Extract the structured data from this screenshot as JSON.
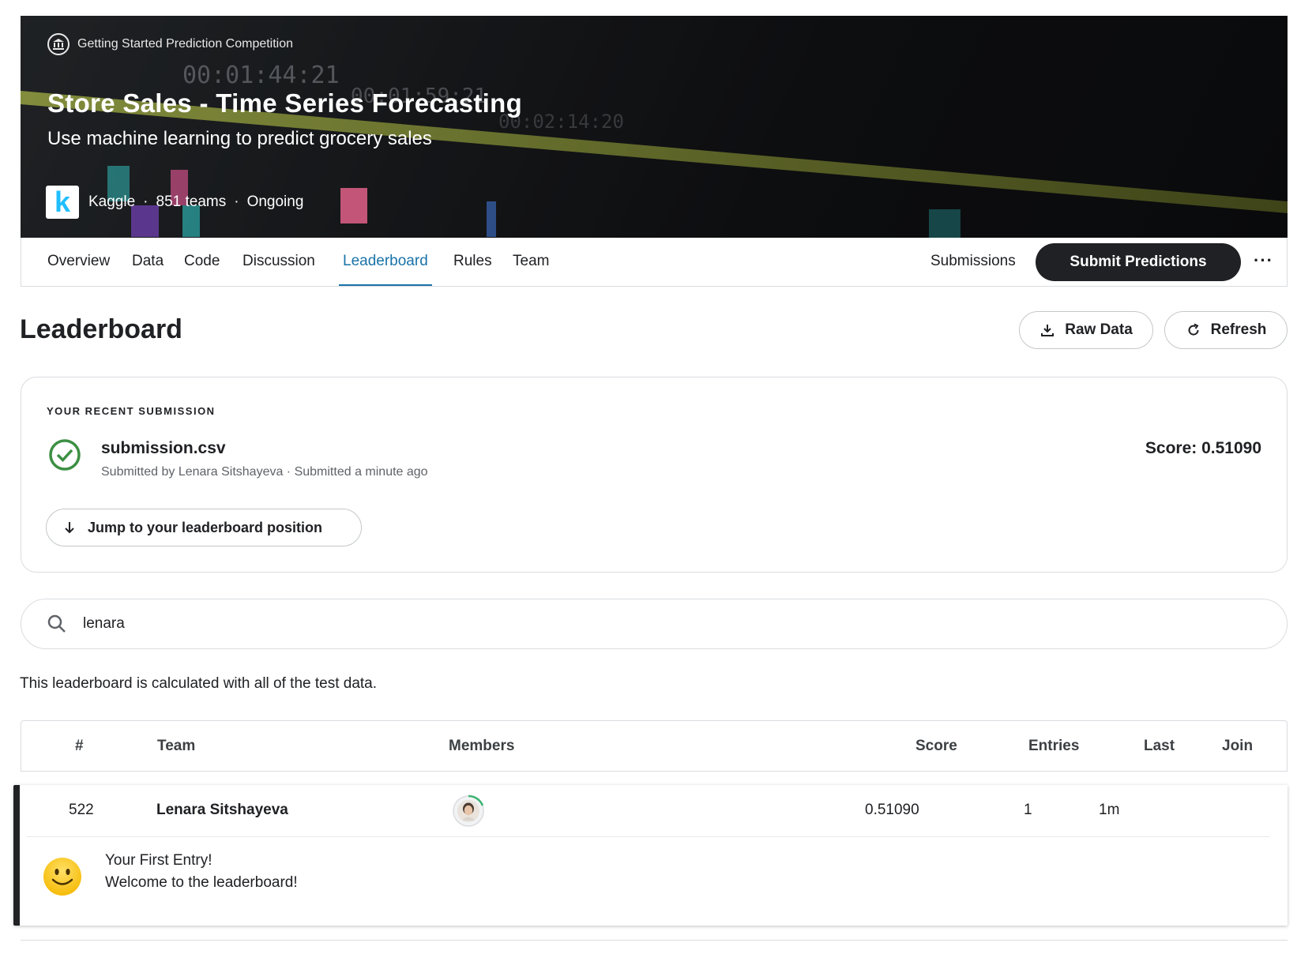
{
  "banner": {
    "competition_type": "Getting Started Prediction Competition",
    "title": "Store Sales - Time Series Forecasting",
    "subtitle": "Use machine learning to predict grocery sales",
    "host": "Kaggle",
    "teams": "851 teams",
    "status": "Ongoing",
    "logo_letter": "k"
  },
  "tabs": [
    {
      "label": "Overview"
    },
    {
      "label": "Data"
    },
    {
      "label": "Code"
    },
    {
      "label": "Discussion"
    },
    {
      "label": "Leaderboard"
    },
    {
      "label": "Rules"
    },
    {
      "label": "Team"
    }
  ],
  "nav_actions": {
    "submissions": "Submissions",
    "submit": "Submit Predictions",
    "more": "···"
  },
  "leaderboard": {
    "title": "Leaderboard",
    "raw_data": "Raw Data",
    "refresh": "Refresh"
  },
  "recent": {
    "label": "YOUR RECENT SUBMISSION",
    "filename": "submission.csv",
    "byline": "Submitted by Lenara Sitshayeva · Submitted a minute ago",
    "score": "Score: 0.51090",
    "jump": "Jump to your leaderboard position"
  },
  "search": {
    "value": "lenara"
  },
  "note": "This leaderboard is calculated with all of the test data.",
  "table": {
    "headers": {
      "rank": "#",
      "team": "Team",
      "members": "Members",
      "score": "Score",
      "entries": "Entries",
      "last": "Last",
      "join": "Join"
    },
    "rows": [
      {
        "rank": "522",
        "team": "Lenara Sitshayeva",
        "score": "0.51090",
        "entries": "1",
        "last": "1m"
      }
    ],
    "welcome_line1": "Your First Entry!",
    "welcome_line2": "Welcome to the leaderboard!"
  },
  "colors": {
    "accent": "#1a73a8",
    "success": "#3c8f43",
    "dark": "#202124"
  }
}
